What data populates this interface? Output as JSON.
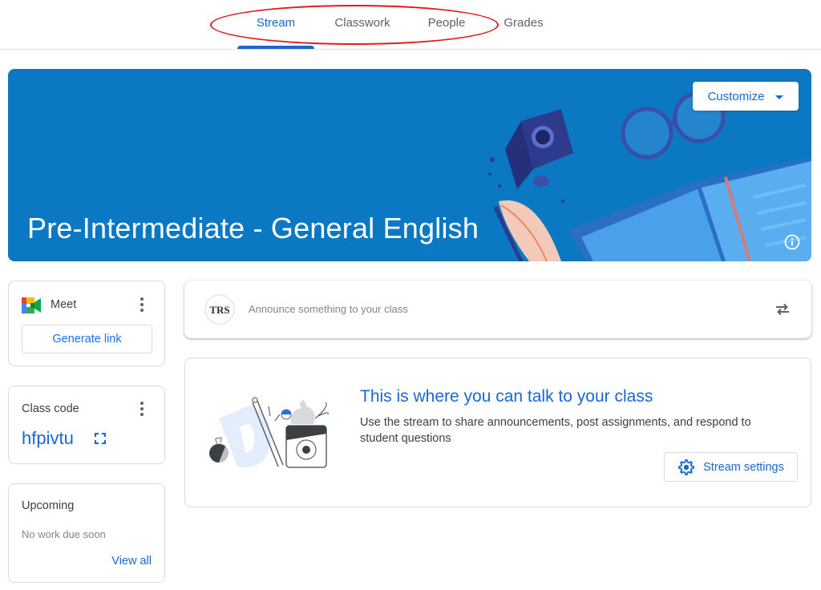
{
  "nav": {
    "tabs": [
      {
        "label": "Stream",
        "active": true
      },
      {
        "label": "Classwork",
        "active": false
      },
      {
        "label": "People",
        "active": false
      },
      {
        "label": "Grades",
        "active": false
      }
    ],
    "accent": "#1967d2",
    "annotation_color": "#e01b1b"
  },
  "banner": {
    "class_title": "Pre-Intermediate - General English",
    "customize_label": "Customize",
    "background": "#0a78c2"
  },
  "meet": {
    "title": "Meet",
    "generate_link_label": "Generate link"
  },
  "class_code": {
    "title": "Class code",
    "code": "hfpivtu"
  },
  "upcoming": {
    "title": "Upcoming",
    "empty_text": "No work due soon",
    "view_all_label": "View all"
  },
  "announce": {
    "placeholder": "Announce something to your class"
  },
  "stream_empty": {
    "heading": "This is where you can talk to your class",
    "description": "Use the stream to share announcements, post assignments, and respond to student questions",
    "settings_label": "Stream settings"
  }
}
